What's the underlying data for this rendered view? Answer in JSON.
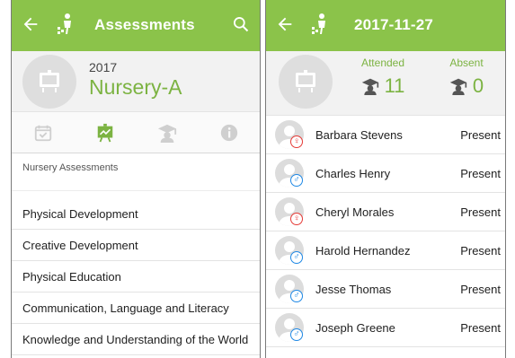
{
  "colors": {
    "accent": "#8bc34a",
    "accent_text": "#7cb342",
    "female": "#e53935",
    "male": "#1e88e5"
  },
  "left": {
    "appbar": {
      "title": "Assessments",
      "back_icon": "arrow-left-icon",
      "logo_icon": "app-logo-icon",
      "search_icon": "search-icon"
    },
    "class": {
      "year": "2017",
      "name": "Nursery-A",
      "avatar_icon": "classroom-board-icon"
    },
    "tabs": [
      {
        "icon": "calendar-check-icon",
        "active": false
      },
      {
        "icon": "presentation-chart-icon",
        "active": true
      },
      {
        "icon": "graduate-icon",
        "active": false
      },
      {
        "icon": "info-icon",
        "active": false
      }
    ],
    "section_label": "Nursery Assessments",
    "items": [
      "Physical Development",
      "Creative Development",
      "Physical Education",
      "Communication, Language and Literacy",
      "Knowledge and Understanding of the World"
    ]
  },
  "right": {
    "appbar": {
      "title": "2017-11-27",
      "back_icon": "arrow-left-icon",
      "logo_icon": "app-logo-icon"
    },
    "stats": {
      "attended_label": "Attended",
      "attended_count": "11",
      "absent_label": "Absent",
      "absent_count": "0"
    },
    "students": [
      {
        "name": "Barbara Stevens",
        "status": "Present",
        "gender": "female"
      },
      {
        "name": "Charles Henry",
        "status": "Present",
        "gender": "male"
      },
      {
        "name": "Cheryl Morales",
        "status": "Present",
        "gender": "female"
      },
      {
        "name": "Harold Hernandez",
        "status": "Present",
        "gender": "male"
      },
      {
        "name": "Jesse Thomas",
        "status": "Present",
        "gender": "male"
      },
      {
        "name": "Joseph Greene",
        "status": "Present",
        "gender": "male"
      }
    ]
  }
}
